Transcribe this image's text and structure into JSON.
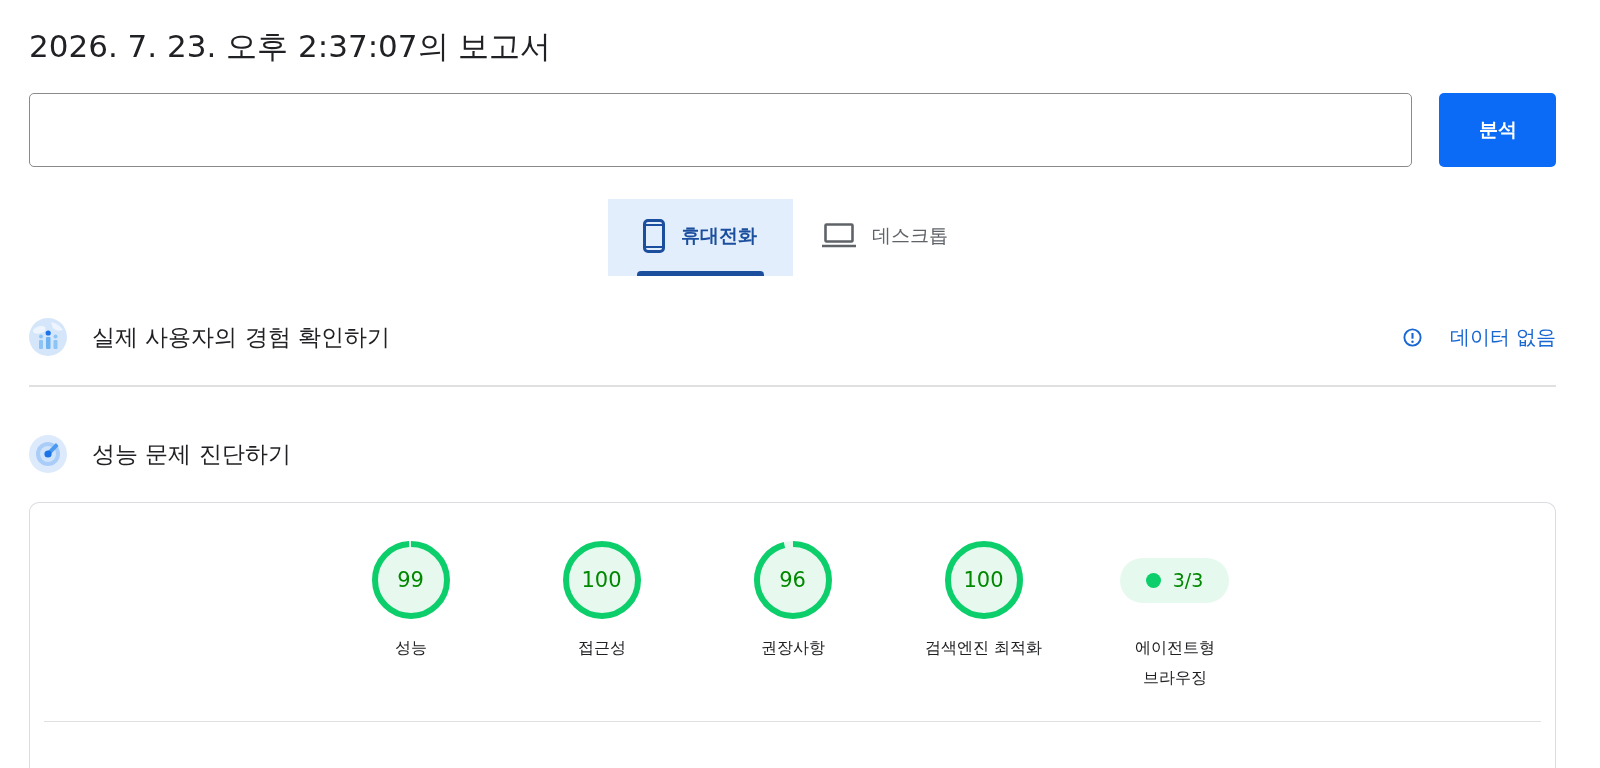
{
  "report": {
    "title": "2026. 7. 23. 오후 2:37:07의 보고서",
    "analyze_button": "분석"
  },
  "tabs": [
    {
      "kind": "phone",
      "label": "휴대전화",
      "selected": true
    },
    {
      "kind": "desktop",
      "label": "데스크톱",
      "selected": false
    }
  ],
  "sections": [
    {
      "kind": "field_data",
      "title": "실제 사용자의 경험 확인하기",
      "status": "데이터 없음"
    },
    {
      "kind": "diagnostics",
      "title": "성능 문제 진단하기",
      "scores": [
        {
          "kind": "gauge",
          "value": "99",
          "level": 0.99,
          "label": "성능"
        },
        {
          "kind": "gauge",
          "value": "100",
          "level": 1,
          "label": "접근성"
        },
        {
          "kind": "gauge",
          "value": "96",
          "level": 0.96,
          "label": "권장사항"
        },
        {
          "kind": "gauge",
          "value": "100",
          "level": 1,
          "label": "검색엔진 최적화"
        },
        {
          "kind": "fraction",
          "value": "3/3",
          "label": "에이전트형 브라우징"
        }
      ]
    }
  ]
}
